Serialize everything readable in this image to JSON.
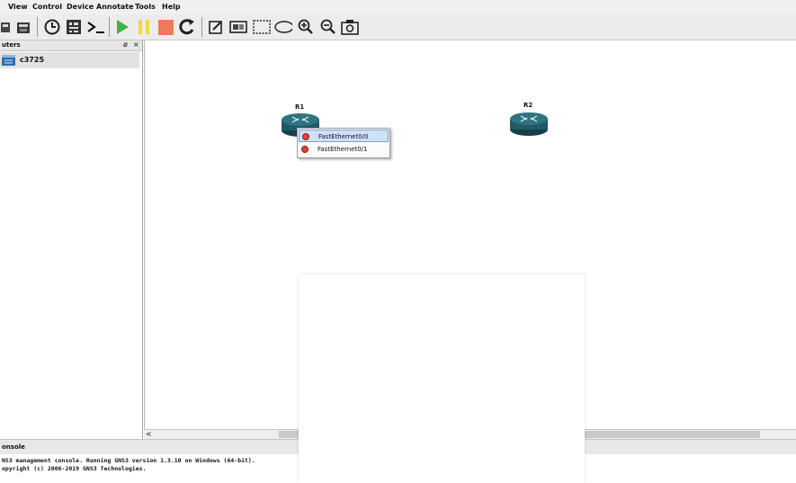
{
  "menu": [
    "View",
    "Control",
    "Device",
    "Annotate",
    "Tools",
    "Help"
  ],
  "toolbar": {
    "icons": [
      "open-project-icon",
      "snapshot-icon",
      "clock-icon",
      "grid-icon",
      "console-icon",
      "start-icon",
      "pause-icon",
      "stop-icon",
      "reload-icon",
      "note-icon",
      "image-icon",
      "rectangle-icon",
      "ellipse-icon",
      "zoom-in-icon",
      "zoom-out-icon",
      "screenshot-icon"
    ]
  },
  "dock": {
    "title": "uters",
    "float_glyph": "ø",
    "close_glyph": "×",
    "device": "c3725"
  },
  "canvas": {
    "routers": [
      {
        "name": "R1"
      },
      {
        "name": "R2"
      }
    ]
  },
  "context_menu": {
    "items": [
      {
        "label": "FastEthernet0/0",
        "highlighted": true
      },
      {
        "label": "FastEthernet0/1",
        "highlighted": false
      }
    ]
  },
  "scroll": {
    "left_arrow": "<"
  },
  "console": {
    "title": "onsole",
    "lines": [
      "NS3 management console. Running GNS3 version 1.3.10 on Windows (64-bit).",
      "opyright (c) 2006-2019 GNS3 Technologies."
    ]
  },
  "colors": {
    "accent_highlight": "#cfe0fb",
    "router": "#1f5a66",
    "port_dot": "#e0403a"
  }
}
